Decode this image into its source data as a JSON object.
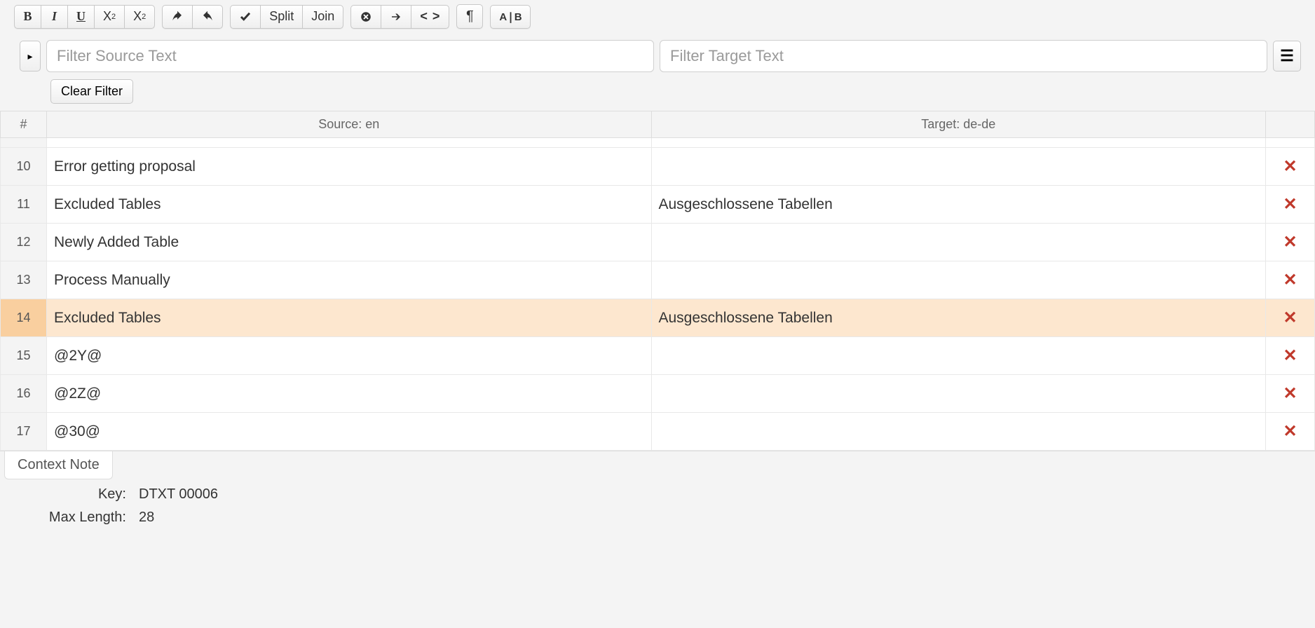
{
  "toolbar": {
    "bold": "B",
    "italic": "I",
    "underline": "U",
    "subscript": "X",
    "subscript_suffix": "2",
    "superscript": "X",
    "superscript_suffix": "2",
    "split": "Split",
    "join": "Join",
    "tags": "< >",
    "select_all": "A❘B"
  },
  "filter": {
    "source_placeholder": "Filter Source Text",
    "target_placeholder": "Filter Target Text",
    "clear_label": "Clear Filter"
  },
  "columns": {
    "num": "#",
    "source": "Source: en",
    "target": "Target: de-de"
  },
  "rows": [
    {
      "num": "10",
      "source": "Error getting proposal",
      "target": "",
      "selected": false
    },
    {
      "num": "11",
      "source": "Excluded Tables",
      "target": "Ausgeschlossene Tabellen",
      "selected": false
    },
    {
      "num": "12",
      "source": "Newly Added Table",
      "target": "",
      "selected": false
    },
    {
      "num": "13",
      "source": "Process Manually",
      "target": "",
      "selected": false
    },
    {
      "num": "14",
      "source": "Excluded Tables",
      "target": "Ausgeschlossene Tabellen",
      "selected": true
    },
    {
      "num": "15",
      "source": "@2Y@",
      "target": "",
      "selected": false
    },
    {
      "num": "16",
      "source": "@2Z@",
      "target": "",
      "selected": false
    },
    {
      "num": "17",
      "source": "@30@",
      "target": "",
      "selected": false
    }
  ],
  "context": {
    "tab_label": "Context Note",
    "key_label": "Key:",
    "key_value": "DTXT 00006",
    "maxlen_label": "Max Length:",
    "maxlen_value": "28"
  }
}
